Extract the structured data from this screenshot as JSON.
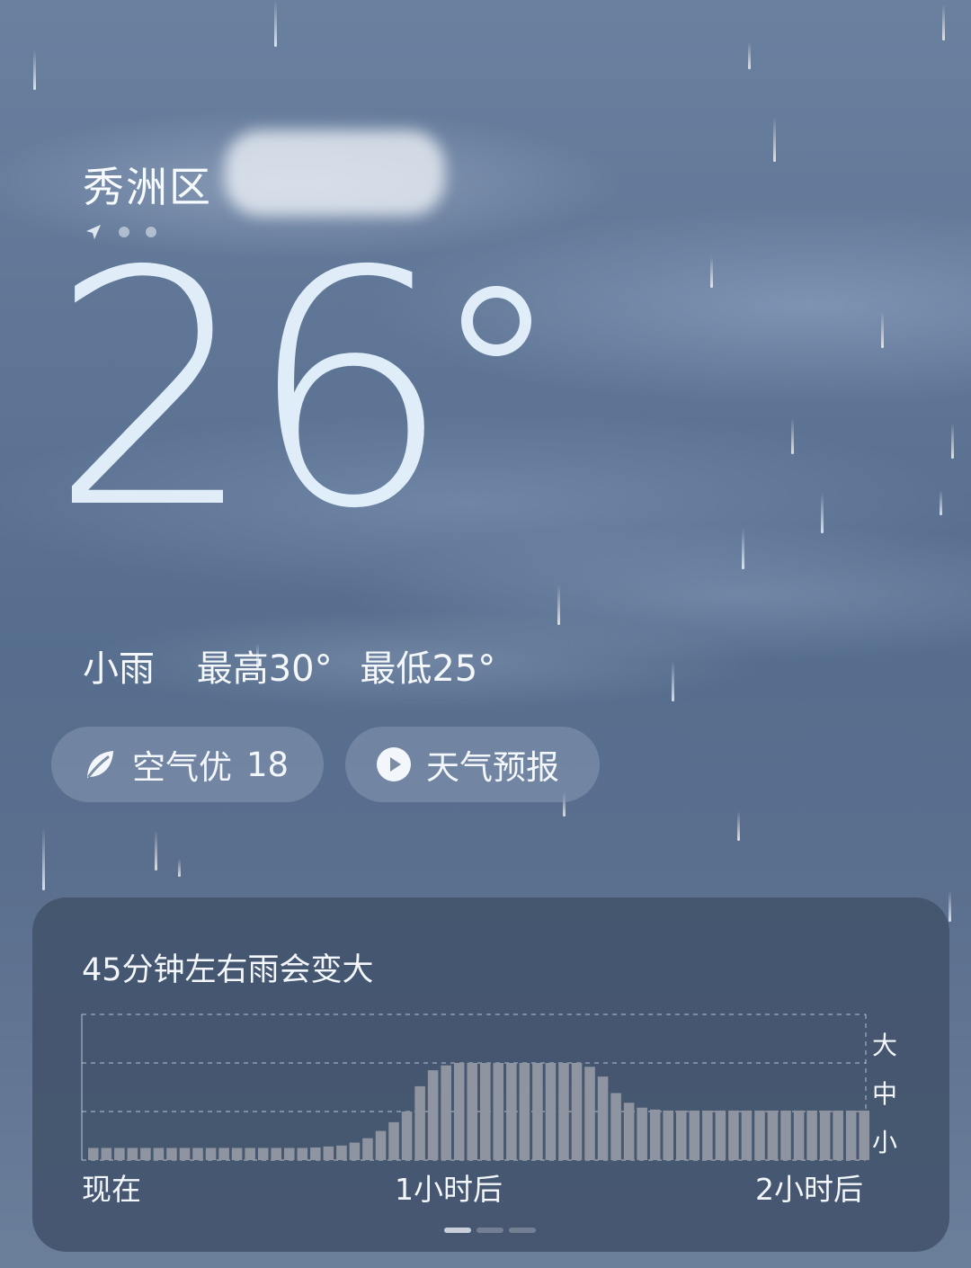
{
  "location": {
    "name": "秀洲区",
    "page_count": 3,
    "active_page": 1
  },
  "weather": {
    "temperature": "26",
    "condition": "小雨",
    "high": "最高30°",
    "low": "最低25°"
  },
  "air_quality": {
    "label": "空气优",
    "value": "18",
    "icon": "leaf-icon"
  },
  "forecast_button": {
    "label": "天气预报",
    "icon": "play-icon"
  },
  "rain_forecast": {
    "title": "45分钟左右雨会变大",
    "time_labels": [
      "现在",
      "1小时后",
      "2小时后"
    ],
    "intensity_labels": [
      "大",
      "中",
      "小"
    ],
    "pages": 3,
    "active_page": 1
  },
  "chart_data": {
    "type": "bar",
    "x": [
      "现在",
      "1小时后",
      "2小时后"
    ],
    "y_levels": [
      "小",
      "中",
      "大"
    ],
    "ylim": [
      0,
      3
    ],
    "values": [
      0.25,
      0.25,
      0.25,
      0.25,
      0.25,
      0.25,
      0.25,
      0.25,
      0.25,
      0.25,
      0.25,
      0.25,
      0.25,
      0.25,
      0.25,
      0.25,
      0.25,
      0.26,
      0.28,
      0.3,
      0.36,
      0.45,
      0.6,
      0.78,
      1.0,
      1.52,
      1.85,
      1.95,
      2.0,
      2.0,
      2.0,
      2.0,
      2.0,
      2.0,
      2.0,
      2.0,
      2.0,
      2.0,
      1.92,
      1.72,
      1.38,
      1.18,
      1.08,
      1.04,
      1.02,
      1.02,
      1.02,
      1.02,
      1.02,
      1.02,
      1.02,
      1.02,
      1.02,
      1.02,
      1.02,
      1.02,
      1.02,
      1.02,
      1.02,
      1.02
    ]
  },
  "colors": {
    "sky_top": "#6a809f",
    "sky_bottom": "#6b7f9b",
    "card": "#42526b",
    "bar": "#8f95a0",
    "text": "#f3f7fb"
  }
}
